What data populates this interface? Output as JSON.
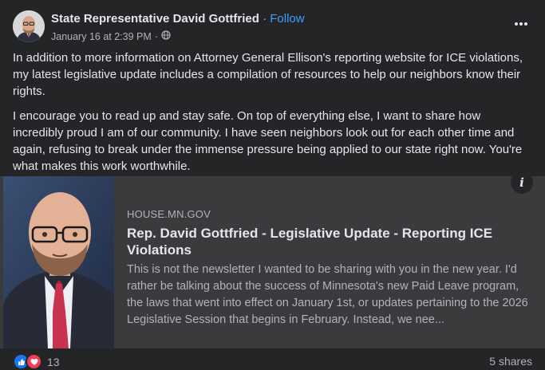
{
  "post": {
    "author": "State Representative David Gottfried",
    "separator": "·",
    "follow_label": "Follow",
    "timestamp": "January 16 at 2:39 PM",
    "meta_separator": "·",
    "audience_icon": "globe-icon",
    "more_icon": "more-horizontal-icon",
    "paragraphs": [
      "In addition to more information on Attorney General Ellison's reporting website for ICE violations, my latest legislative update includes a compilation of resources to help our neighbors know their rights.",
      "I encourage you to read up and stay safe. On top of everything else, I want to share how incredibly proud I am of our community. I have seen neighbors look out for each other time and again, refusing to break under the immense pressure being applied to our state right now. You're what makes this work worthwhile."
    ]
  },
  "link_card": {
    "domain": "HOUSE.MN.GOV",
    "title": "Rep. David Gottfried - Legislative Update - Reporting ICE Violations",
    "description": "This is not the newsletter I wanted to be sharing with you in the new year. I'd rather be talking about the success of Minnesota's new Paid Leave program, the laws that went into effect on January 1st, or updates pertaining to the 2026 Legislative Session that begins in February. Instead, we nee...",
    "info_icon": "info-icon"
  },
  "footer": {
    "reaction_count": "13",
    "shares": "5 shares"
  },
  "colors": {
    "background": "#242526",
    "card": "#3a3b3c",
    "link": "#4599ff",
    "like": "#1877f2",
    "love": "#f33e58"
  }
}
